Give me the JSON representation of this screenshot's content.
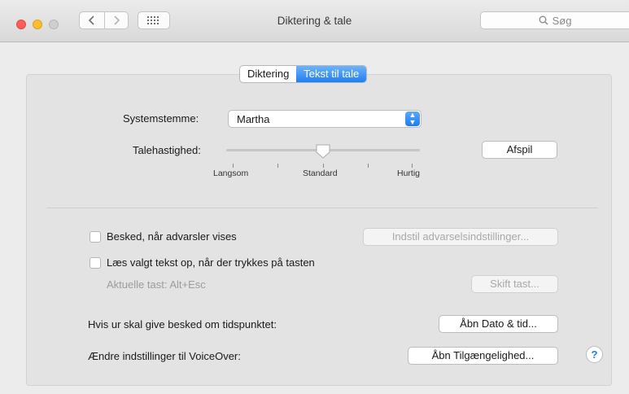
{
  "window": {
    "title": "Diktering & tale",
    "search_placeholder": "Søg"
  },
  "tabs": [
    {
      "label": "Diktering",
      "selected": false
    },
    {
      "label": "Tekst til tale",
      "selected": true
    }
  ],
  "voice": {
    "label": "Systemstemme:",
    "value": "Martha"
  },
  "rate": {
    "label": "Talehastighed:",
    "value_fraction": 0.5,
    "slow": "Langsom",
    "normal": "Standard",
    "fast": "Hurtig",
    "play_button": "Afspil"
  },
  "alerts": {
    "label": "Besked, når advarsler vises",
    "checked": false,
    "button": "Indstil advarselsindstillinger..."
  },
  "speak_selected": {
    "label": "Læs valgt tekst op, når der trykkes på tasten",
    "checked": false,
    "current_key": "Aktuelle tast: Alt+Esc",
    "button": "Skift tast..."
  },
  "clock": {
    "label": "Hvis ur skal give besked om tidspunktet:",
    "button": "Åbn Dato & tid..."
  },
  "voiceover": {
    "label": "Ændre indstillinger til VoiceOver:",
    "button": "Åbn Tilgængelighed..."
  },
  "help": {
    "label": "?"
  },
  "colors": {
    "accent": "#1f7ef1",
    "close": "#fc5f57",
    "minimize": "#fdbc2e"
  }
}
